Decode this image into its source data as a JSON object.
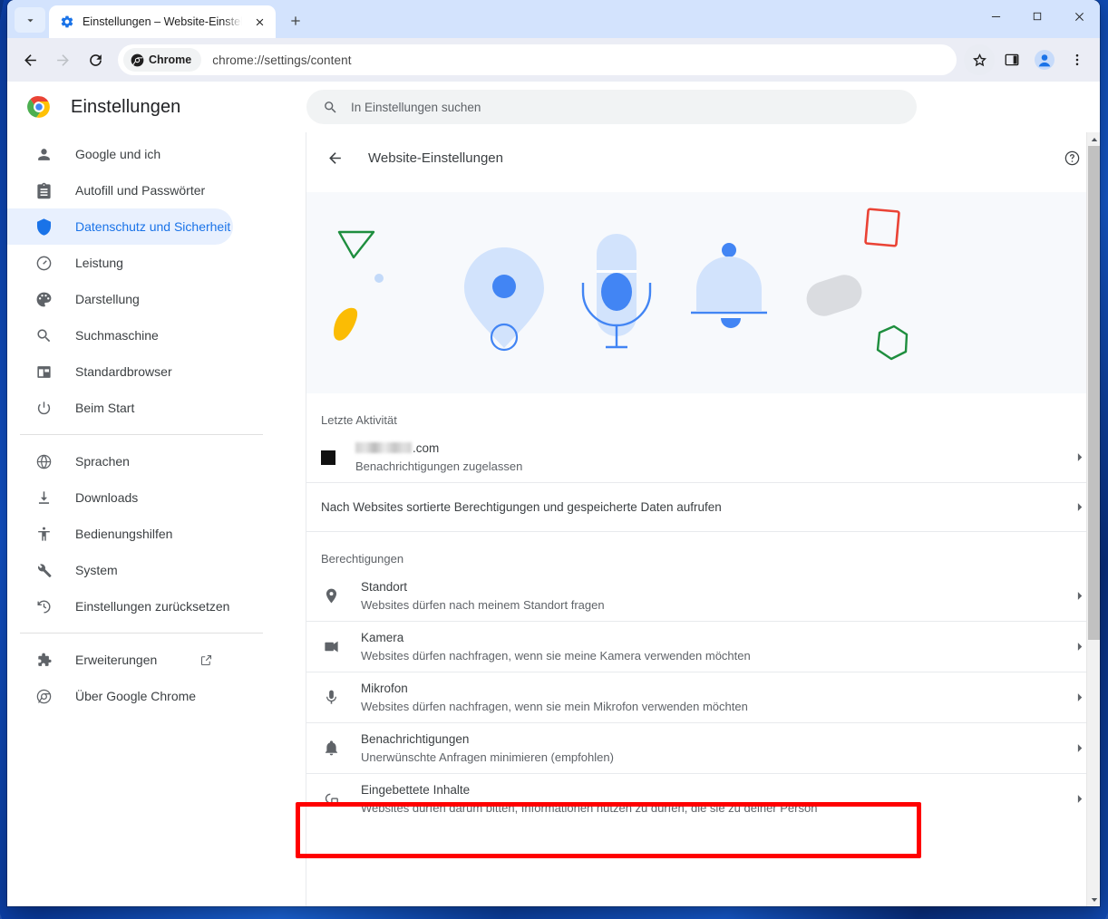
{
  "window": {
    "tab": {
      "title": "Einstellungen – Website-Einstell",
      "favicon": "gear-icon",
      "close_label": "×"
    },
    "tab_search_label": "Tabsuche",
    "new_tab_label": "+",
    "controls": {
      "minimize": "–",
      "maximize": "□",
      "close": "✕"
    }
  },
  "toolbar": {
    "back_label": "Zurück",
    "forward_label": "Vorwärts",
    "reload_label": "Neu laden",
    "chip_label": "Chrome",
    "url": "chrome://settings/content",
    "bookmark_label": "Lesezeichen setzen",
    "side_panel_label": "Seitenleiste",
    "profile_label": "Profil",
    "menu_label": "Chrome anpassen und einstellen"
  },
  "settings": {
    "brand_title": "Einstellungen",
    "search_placeholder": "In Einstellungen suchen",
    "sidebar": [
      {
        "label": "Google und ich",
        "icon": "person-icon",
        "active": false
      },
      {
        "label": "Autofill und Passwörter",
        "icon": "clipboard-icon",
        "active": false
      },
      {
        "label": "Datenschutz und Sicherheit",
        "icon": "shield-icon",
        "active": true
      },
      {
        "label": "Leistung",
        "icon": "speedometer-icon",
        "active": false
      },
      {
        "label": "Darstellung",
        "icon": "palette-icon",
        "active": false
      },
      {
        "label": "Suchmaschine",
        "icon": "search-icon",
        "active": false
      },
      {
        "label": "Standardbrowser",
        "icon": "browser-window-icon",
        "active": false
      },
      {
        "label": "Beim Start",
        "icon": "power-icon",
        "active": false
      },
      {
        "label": "Sprachen",
        "icon": "globe-icon",
        "active": false
      },
      {
        "label": "Downloads",
        "icon": "download-icon",
        "active": false
      },
      {
        "label": "Bedienungshilfen",
        "icon": "accessibility-icon",
        "active": false
      },
      {
        "label": "System",
        "icon": "wrench-icon",
        "active": false
      },
      {
        "label": "Einstellungen zurücksetzen",
        "icon": "history-restore-icon",
        "active": false
      },
      {
        "label": "Erweiterungen",
        "icon": "puzzle-icon",
        "active": false,
        "external": true
      },
      {
        "label": "Über Google Chrome",
        "icon": "chrome-icon",
        "active": false
      }
    ]
  },
  "content": {
    "breadcrumb_title": "Website-Einstellungen",
    "help_label": "Hilfe",
    "recent_activity_label": "Letzte Aktivität",
    "recent_activity_item": {
      "site_suffix": ".com",
      "site_redacted": true,
      "status": "Benachrichtigungen zugelassen"
    },
    "view_all_label": "Nach Websites sortierte Berechtigungen und gespeicherte Daten aufrufen",
    "permissions_label": "Berechtigungen",
    "permissions": [
      {
        "title": "Standort",
        "subtitle": "Websites dürfen nach meinem Standort fragen",
        "icon": "location-pin-icon",
        "highlighted": false
      },
      {
        "title": "Kamera",
        "subtitle": "Websites dürfen nachfragen, wenn sie meine Kamera verwenden möchten",
        "icon": "camera-icon",
        "highlighted": false
      },
      {
        "title": "Mikrofon",
        "subtitle": "Websites dürfen nachfragen, wenn sie mein Mikrofon verwenden möchten",
        "icon": "microphone-icon",
        "highlighted": false
      },
      {
        "title": "Benachrichtigungen",
        "subtitle": "Unerwünschte Anfragen minimieren (empfohlen)",
        "icon": "bell-icon",
        "highlighted": true
      },
      {
        "title": "Eingebettete Inhalte",
        "subtitle": "Websites dürfen darum bitten, Informationen nutzen zu dürfen, die sie zu deiner Person",
        "icon": "embedded-content-icon",
        "highlighted": false
      }
    ]
  },
  "colors": {
    "accent": "#1a73e8",
    "active_pill": "#e8f0fe",
    "tabstrip": "#d3e3fd",
    "toolbar": "#ebedf5",
    "hero_bg": "#f7f9fc",
    "annotation": "#ff0000",
    "text_primary": "#3c4043",
    "text_secondary": "#5f6368"
  }
}
